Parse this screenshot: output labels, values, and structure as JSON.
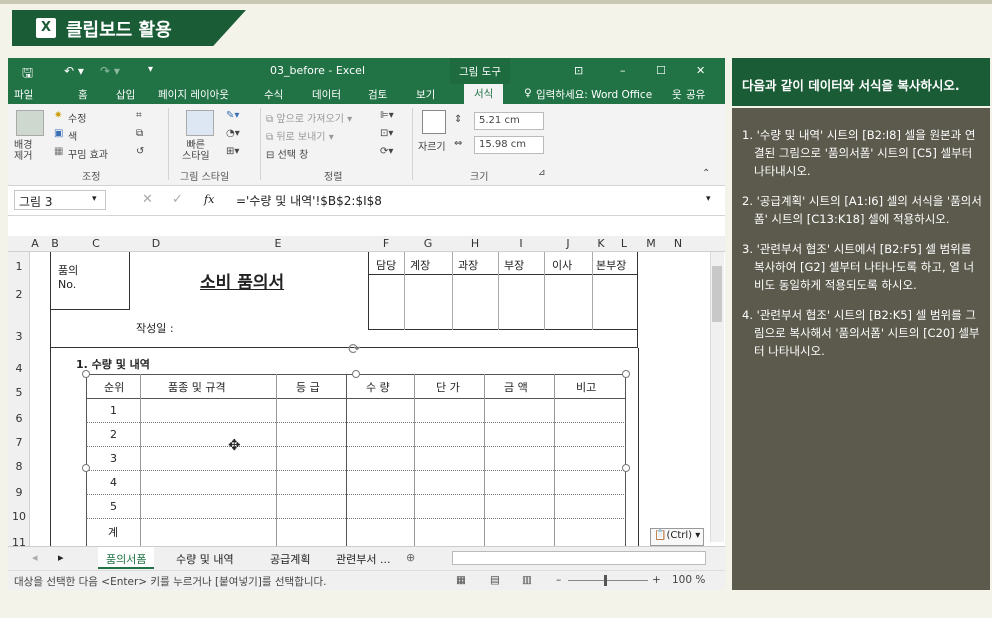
{
  "banner": {
    "title": "클립보드 활용"
  },
  "excel": {
    "filename": "03_before - Excel",
    "context_tab": "그림 도구",
    "tabs": [
      "파일",
      "홈",
      "삽입",
      "페이지 레이아웃",
      "수식",
      "데이터",
      "검토",
      "보기",
      "서식"
    ],
    "tell_me": "입력하세요: Word Office",
    "share": "공유",
    "ribbon": {
      "adjust": {
        "remove_bg": "배경\n제거",
        "corrections": "수정",
        "color": "색",
        "artistic": "꾸밈 효과",
        "label": "조정"
      },
      "styles": {
        "quick": "빠른\n스타일",
        "label": "그림 스타일"
      },
      "arrange": {
        "bring_forward": "앞으로 가져오기",
        "send_backward": "뒤로 보내기",
        "selection_pane": "선택 창",
        "label": "정렬"
      },
      "size": {
        "crop": "자르기",
        "height": "5.21 cm",
        "width": "15.98 cm",
        "label": "크기"
      }
    },
    "name_box": "그림 3",
    "formula": "='수량 및 내역'!$B$2:$I$8",
    "columns": [
      "A",
      "B",
      "C",
      "D",
      "E",
      "F",
      "G",
      "H",
      "I",
      "J",
      "K",
      "L",
      "M",
      "N"
    ],
    "rows": [
      "1",
      "2",
      "3",
      "4",
      "5",
      "6",
      "7",
      "8",
      "9",
      "10",
      "11"
    ],
    "form": {
      "title": "소비 품의서",
      "no_label": "품의\nNo.",
      "date_label": "작성일 :",
      "approvals": [
        "담당",
        "계장",
        "과장",
        "부장",
        "이사",
        "본부장"
      ],
      "section": "1. 수량 및 내역",
      "headers": [
        "순위",
        "품종 및 규격",
        "등 급",
        "수 량",
        "단 가",
        "금 액",
        "비고"
      ],
      "ranks": [
        "1",
        "2",
        "3",
        "4",
        "5",
        "계"
      ]
    },
    "paste_ctrl": "(Ctrl)",
    "sheets": [
      "품의서폼",
      "수량 및 내역",
      "공급계획",
      "관련부서 ..."
    ],
    "status_text": "대상을 선택한 다음 <Enter> 키를 누르거나 [붙여넣기]를 선택합니다.",
    "zoom": "100 %"
  },
  "panel": {
    "title": "다음과 같이 데이터와 서식을 복사하시오.",
    "items": [
      "1. '수량 및 내역' 시트의 [B2:I8] 셀을 원본과 연결된 그림으로 '품의서폼' 시트의 [C5] 셀부터 나타내시오.",
      "2. '공급계획' 시트의 [A1:I6] 셀의 서식을 '품의서폼' 시트의 [C13:K18] 셀에 적용하시오.",
      "3. '관련부서 협조' 시트에서 [B2:F5] 셀 범위를 복사하여 [G2] 셀부터 나타나도록 하고, 열 너비도 동일하게 적용되도록 하시오.",
      "4. '관련부서 협조' 시트의 [B2:K5] 셀 범위를 그림으로 복사해서 '품의서폼' 시트의 [C20] 셀부터 나타내시오."
    ]
  },
  "colors": {
    "excel_green": "#217346",
    "banner_green": "#1a5c36",
    "panel_bg": "#5b5a4c"
  }
}
